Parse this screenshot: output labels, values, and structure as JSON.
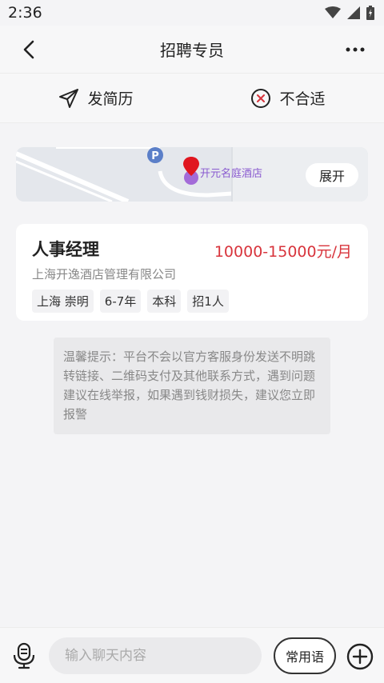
{
  "status": {
    "time": "2:36"
  },
  "nav": {
    "title": "招聘专员"
  },
  "actions": {
    "send_resume": "发简历",
    "not_suitable": "不合适"
  },
  "map": {
    "poi_label": "开元名庭酒店",
    "expand_label": "展开"
  },
  "job": {
    "title": "人事经理",
    "salary": "10000-15000元/月",
    "company": "上海开逸酒店管理有限公司",
    "tags": [
      "上海 崇明",
      "6-7年",
      "本科",
      "招1人"
    ]
  },
  "notice": {
    "text": "温馨提示：平台不会以官方客服身份发送不明跳转链接、二维码支付及其他联系方式，遇到问题建议在线举报，如果遇到钱财损失，建议您立即报警"
  },
  "input": {
    "placeholder": "输入聊天内容",
    "phrases_label": "常用语"
  },
  "colors": {
    "salary": "#d8343c",
    "map_pin": "#e0161f",
    "poi": "#8a5bd0"
  }
}
